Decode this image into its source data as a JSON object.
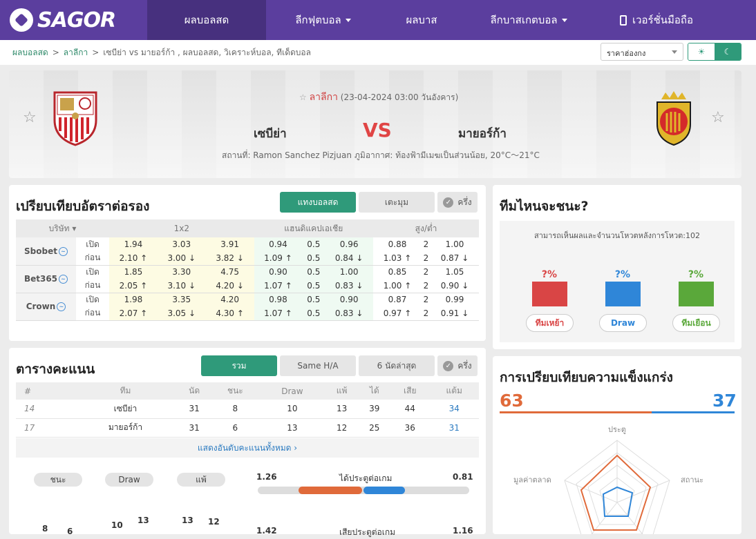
{
  "nav": {
    "logo": "SAGOR",
    "items": [
      "ผลบอลสด",
      "ลีกฟุตบอล",
      "ผลบาส",
      "ลีกบาสเกตบอล",
      "เวอร์ชั่นมือถือ"
    ]
  },
  "breadcrumb": {
    "home": "ผลบอลสด",
    "league": "ลาลีกา",
    "current": "เซบีย่า vs มายอร์ก้า , ผลบอลสด, วิเคราะห์บอล, ทีเด็ดบอล"
  },
  "odds_select": "ราคาฮ่องกง",
  "theme": {
    "light_icon": "☀",
    "dark_icon": "☾"
  },
  "match": {
    "league": "ลาลีกา",
    "datetime": "(23-04-2024 03:00 วันอังคาร)",
    "home": "เซบีย่า",
    "away": "มายอร์ก้า",
    "vs": "VS",
    "venue": "สถานที่: Ramon Sanchez Pizjuan",
    "weather": "ภูมิอากาศ: ท้องฟ้ามีเมฆเป็นส่วนน้อย, 20°C～21°C"
  },
  "odds": {
    "title": "เปรียบเทียบอัตราต่อรอง",
    "tabs": [
      "แทงบอลสด",
      "เตะมุม",
      "ครึ่ง"
    ],
    "headers": {
      "company": "บริษัท",
      "x12": "1x2",
      "handicap": "แฮนดิแคปเอเชีย",
      "ou": "สูง/ต่ำ"
    },
    "open_label": "เปิด",
    "before_label": "ก่อน",
    "rows": [
      {
        "bookie": "Sbobet",
        "open": [
          "1.94",
          "3.03",
          "3.91",
          "0.94",
          "0.5",
          "0.96",
          "0.88",
          "2",
          "1.00"
        ],
        "close": [
          "2.10 ↑",
          "3.00 ↓",
          "3.82 ↓",
          "1.09 ↑",
          "0.5",
          "0.84 ↓",
          "1.03 ↑",
          "2",
          "0.87 ↓"
        ],
        "dir": [
          "u",
          "d",
          "d",
          "u",
          "",
          "d",
          "u",
          "",
          "d"
        ]
      },
      {
        "bookie": "Bet365",
        "open": [
          "1.85",
          "3.30",
          "4.75",
          "0.90",
          "0.5",
          "1.00",
          "0.85",
          "2",
          "1.05"
        ],
        "close": [
          "2.05 ↑",
          "3.10 ↓",
          "4.20 ↓",
          "1.07 ↑",
          "0.5",
          "0.83 ↓",
          "1.00 ↑",
          "2",
          "0.90 ↓"
        ],
        "dir": [
          "u",
          "d",
          "d",
          "u",
          "",
          "d",
          "u",
          "",
          "d"
        ]
      },
      {
        "bookie": "Crown",
        "open": [
          "1.98",
          "3.35",
          "4.20",
          "0.98",
          "0.5",
          "0.90",
          "0.87",
          "2",
          "0.99"
        ],
        "close": [
          "2.07 ↑",
          "3.05 ↓",
          "4.30 ↑",
          "1.07 ↑",
          "0.5",
          "0.83 ↓",
          "0.97 ↑",
          "2",
          "0.91 ↓"
        ],
        "dir": [
          "u",
          "d",
          "u",
          "u",
          "",
          "d",
          "u",
          "",
          "d"
        ]
      }
    ]
  },
  "standings": {
    "title": "ตารางคะแนน",
    "tabs": [
      "รวม",
      "Same H/A",
      "6 นัดล่าสุด",
      "ครึ่ง"
    ],
    "headers": [
      "#",
      "ทีม",
      "นัด",
      "ชนะ",
      "Draw",
      "แพ้",
      "ได้",
      "เสีย",
      "แต้ม"
    ],
    "rows": [
      [
        "14",
        "เซบีย่า",
        "31",
        "8",
        "10",
        "13",
        "39",
        "44",
        "34"
      ],
      [
        "17",
        "มายอร์ก้า",
        "31",
        "6",
        "13",
        "12",
        "25",
        "36",
        "31"
      ]
    ],
    "show_all": "แสดงอันดับคะแนนทั้งหมด ›",
    "legend": [
      "ชนะ",
      "Draw",
      "แพ้"
    ],
    "goals_per_game": {
      "label": "ได้ประตูต่อเกม",
      "home": "1.26",
      "away": "0.81"
    },
    "bottom_numbers": [
      "8",
      "6",
      "10",
      "13",
      "13",
      "12",
      "1.42",
      "1.16"
    ],
    "bottom_label": "เสียประตูต่อเกม"
  },
  "vote": {
    "title": "ทีมไหนจะชนะ?",
    "caption": "สามารถเห็นผลและจำนวนโหวตหลังการโหวต:102",
    "options": [
      {
        "pct": "?%",
        "label": "ทีมเหย้า",
        "color": "#d94545"
      },
      {
        "pct": "?%",
        "label": "Draw",
        "color": "#2f86d8"
      },
      {
        "pct": "?%",
        "label": "ทีมเยือน",
        "color": "#5aa83a"
      }
    ]
  },
  "strength": {
    "title": "การเปรียบเทียบความแข็งแกร่ง",
    "home": "63",
    "away": "37",
    "home_color": "#e06a3a",
    "away_color": "#2f86d8",
    "axes": [
      "ประตู",
      "สถานะ",
      "มูลค่าตลาด"
    ]
  }
}
